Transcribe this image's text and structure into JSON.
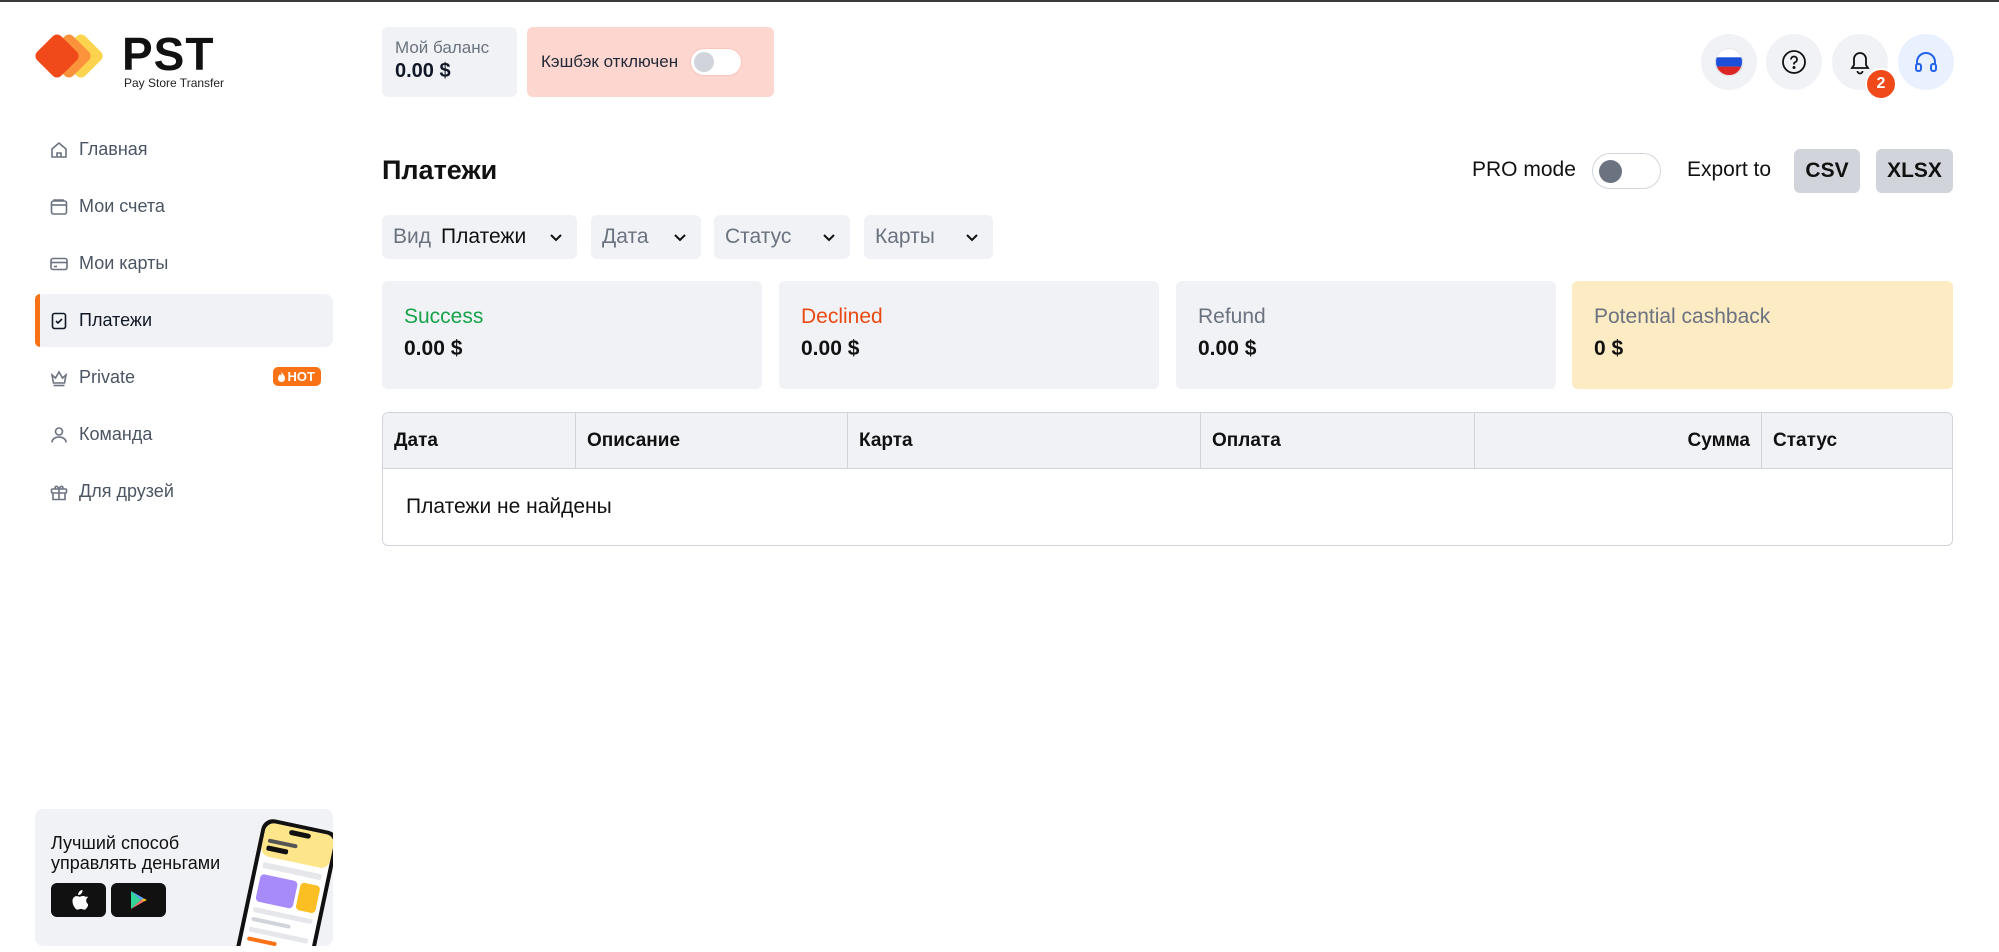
{
  "brand": {
    "name": "PST",
    "tagline": "Pay Store Transfer",
    "accent": "#f97316"
  },
  "sidebar": {
    "items": [
      {
        "label": "Главная",
        "icon": "home-icon"
      },
      {
        "label": "Мои счета",
        "icon": "wallet-icon"
      },
      {
        "label": "Мои карты",
        "icon": "card-icon"
      },
      {
        "label": "Платежи",
        "icon": "receipt-icon",
        "active": true
      },
      {
        "label": "Private",
        "icon": "crown-icon",
        "badge": "HOT"
      },
      {
        "label": "Команда",
        "icon": "user-icon"
      },
      {
        "label": "Для друзей",
        "icon": "gift-icon"
      }
    ],
    "promo": {
      "text": "Лучший способ управлять деньгами"
    }
  },
  "topbar": {
    "balance_caption": "Мой баланс",
    "balance_value": "0.00 $",
    "cashback_label": "Кэшбэк отключен",
    "notifications_count": "2"
  },
  "page": {
    "title": "Платежи",
    "pro_mode_label": "PRO mode",
    "export_label": "Export to",
    "export_csv": "CSV",
    "export_xlsx": "XLSX"
  },
  "filters": {
    "view_label": "Вид",
    "view_value": "Платежи",
    "date_label": "Дата",
    "status_label": "Статус",
    "cards_label": "Карты"
  },
  "stats": [
    {
      "name": "Success",
      "amount": "0.00 $",
      "color": "#16a34a"
    },
    {
      "name": "Declined",
      "amount": "0.00 $",
      "color": "#ea4a12"
    },
    {
      "name": "Refund",
      "amount": "0.00 $",
      "color": "#6b7280"
    },
    {
      "name": "Potential cashback",
      "amount": "0 $",
      "color": "#6b7280"
    }
  ],
  "table": {
    "columns": [
      "Дата",
      "Описание",
      "Карта",
      "Оплата",
      "Сумма",
      "Статус"
    ],
    "empty_text": "Платежи не найдены"
  }
}
